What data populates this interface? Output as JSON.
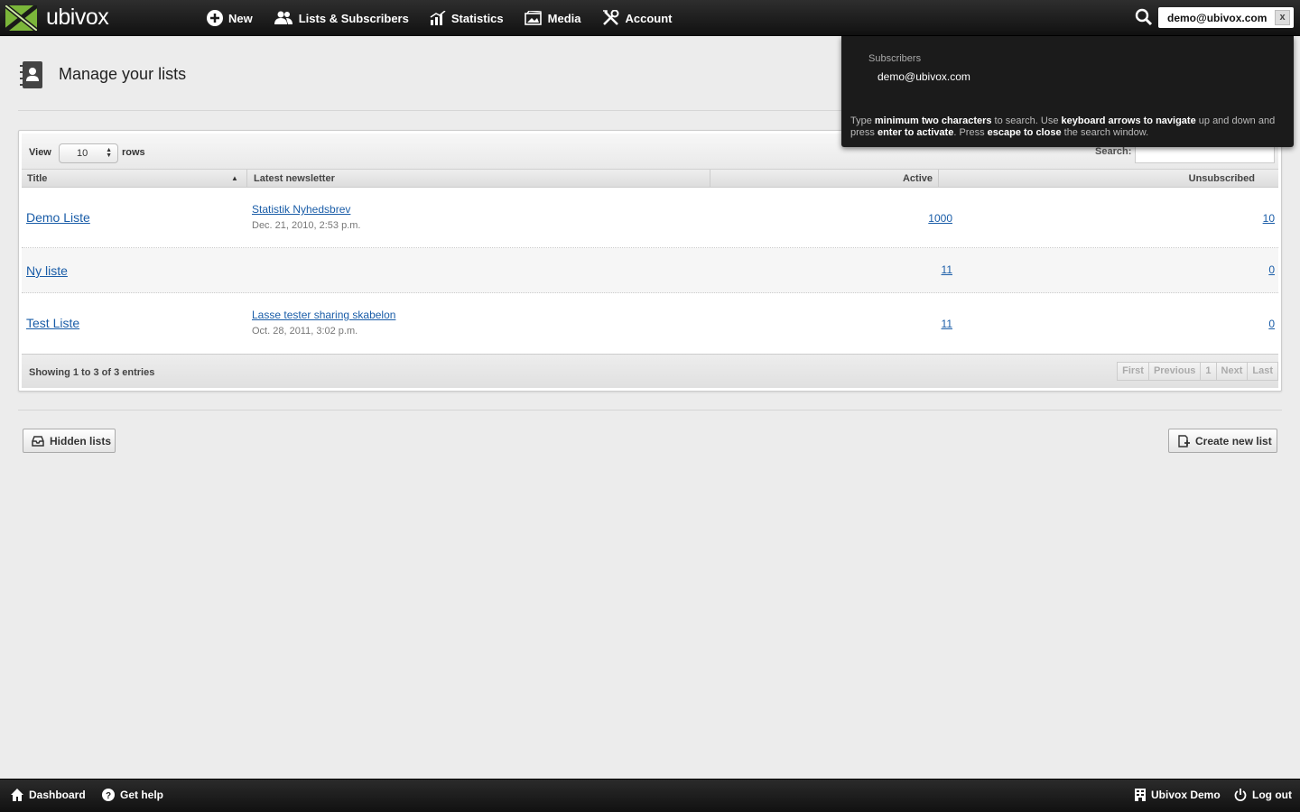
{
  "app": {
    "logo_text": "ubivox"
  },
  "nav": {
    "items": [
      {
        "label": "New",
        "icon": "plus-circle-icon"
      },
      {
        "label": "Lists & Subscribers",
        "icon": "users-icon"
      },
      {
        "label": "Statistics",
        "icon": "chart-icon"
      },
      {
        "label": "Media",
        "icon": "image-icon"
      },
      {
        "label": "Account",
        "icon": "tools-icon"
      }
    ],
    "search_value": "demo@ubivox.com",
    "search_clear": "x"
  },
  "search_popup": {
    "section": "Subscribers",
    "result": "demo@ubivox.com",
    "help": {
      "t1": "Type ",
      "b1": "minimum two characters",
      "t2": " to search. Use ",
      "b2": "keyboard arrows to navigate",
      "t3": " up and down and press ",
      "b3": "enter to activate",
      "t4": ". Press ",
      "b4": "escape to close",
      "t5": " the search window."
    }
  },
  "page": {
    "title": "Manage your lists"
  },
  "table": {
    "view_label": "View",
    "rows_value": "10",
    "rows_label": "rows",
    "search_label": "Search:",
    "columns": [
      "Title",
      "Latest newsletter",
      "Active",
      "Unsubscribed"
    ],
    "rows": [
      {
        "title": "Demo Liste",
        "newsletter": "Statistik Nyhedsbrev",
        "date": "Dec. 21, 2010, 2:53 p.m.",
        "active": "1000",
        "unsubscribed": "10"
      },
      {
        "title": "Ny liste",
        "newsletter": "",
        "date": "",
        "active": "11",
        "unsubscribed": "0"
      },
      {
        "title": "Test Liste",
        "newsletter": "Lasse tester sharing skabelon",
        "date": "Oct. 28, 2011, 3:02 p.m.",
        "active": "11",
        "unsubscribed": "0"
      }
    ],
    "info": "Showing 1 to 3 of 3 entries",
    "pager": [
      "First",
      "Previous",
      "1",
      "Next",
      "Last"
    ]
  },
  "buttons": {
    "hidden_lists": "Hidden lists",
    "create_new_list": "Create new list"
  },
  "footer": {
    "dashboard": "Dashboard",
    "help": "Get help",
    "account": "Ubivox Demo",
    "logout": "Log out"
  },
  "colors": {
    "brand_green": "#7bb63a",
    "link": "#1a5da8",
    "topbar": "#1a1a1a"
  }
}
